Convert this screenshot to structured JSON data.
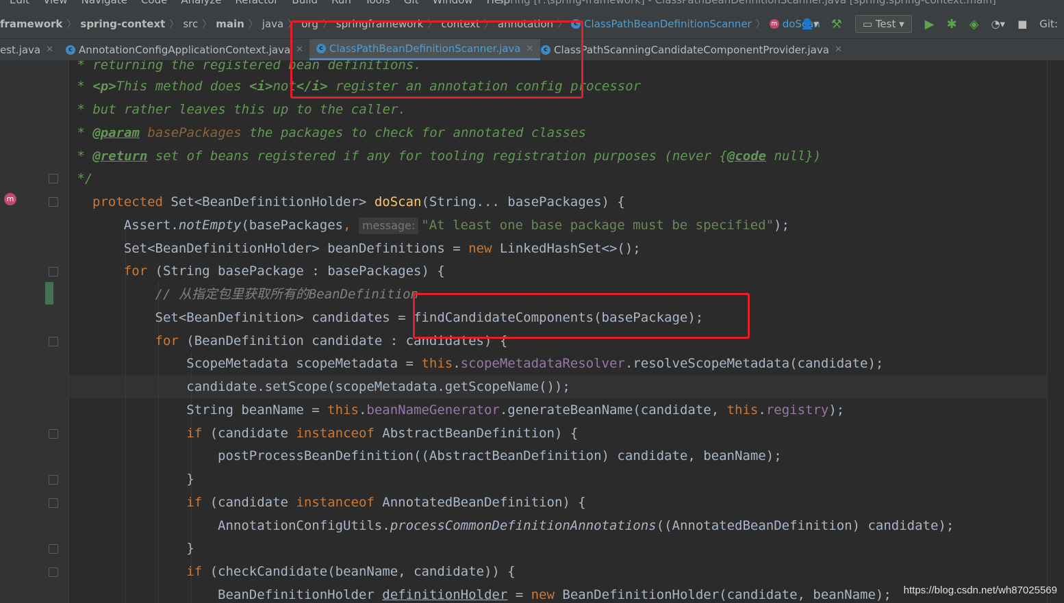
{
  "menu": {
    "items": [
      "Edit",
      "View",
      "Navigate",
      "Code",
      "Analyze",
      "Refactor",
      "Build",
      "Run",
      "Tools",
      "Git",
      "Window",
      "Help"
    ],
    "window_title": "spring [F:\\spring-framework] - ClassPathBeanDefinitionScanner.java [spring.spring-context.main]"
  },
  "breadcrumb": {
    "items": [
      "framework",
      "spring-context",
      "src",
      "main",
      "java",
      "org",
      "springframework",
      "context",
      "annotation"
    ],
    "class_crumb": "ClassPathBeanDefinitionScanner",
    "method_crumb": "doScan"
  },
  "toolbar": {
    "run_config": "Test",
    "git_label": "Git:"
  },
  "tabs": [
    {
      "label": "est.java",
      "active": false
    },
    {
      "label": "AnnotationConfigApplicationContext.java",
      "active": false
    },
    {
      "label": "ClassPathBeanDefinitionScanner.java",
      "active": true
    },
    {
      "label": "ClassPathScanningCandidateComponentProvider.java",
      "active": false
    }
  ],
  "code": {
    "doc1": " * returning the registered bean definitions.",
    "doc2a": " * ",
    "doc2b": "<p>",
    "doc2c": "This method does ",
    "doc2d": "<i>",
    "doc2e": "not",
    "doc2f": "</i>",
    "doc2g": " register an annotation config processor",
    "doc3": " * but rather leaves this up to the caller.",
    "doc4a": " * ",
    "doc4b": "@param",
    "doc4c": " basePackages",
    "doc4d": " the packages to check for annotated classes",
    "doc5a": " * ",
    "doc5b": "@return",
    "doc5c": " set of beans registered if any for tooling registration purposes (never {",
    "doc5d": "@code",
    "doc5e": " null})",
    "doc6": " */",
    "l7a": "protected",
    "l7b": " Set<BeanDefinitionHolder> ",
    "l7c": "doScan",
    "l7d": "(String... basePackages) {",
    "l8a": "    Assert.",
    "l8b": "notEmpty",
    "l8c": "(basePackages",
    "l8d": ", ",
    "l8hint": "message:",
    "l8e": "\"At least one base package must be specified\"",
    "l8f": ");",
    "l9a": "    Set<BeanDefinitionHolder> beanDefinitions = ",
    "l9b": "new",
    "l9c": " LinkedHashSet<>();",
    "l10a": "    ",
    "l10b": "for",
    "l10c": " (String basePackage : basePackages) {",
    "l11": "        // 从指定包里获取所有的BeanDefinition",
    "l12": "        Set<BeanDefinition> candidates = findCandidateComponents(basePackage);",
    "l13a": "        ",
    "l13b": "for",
    "l13c": " (BeanDefinition candidate : candidates) {",
    "l14a": "            ScopeMetadata scopeMetadata = ",
    "l14b": "this",
    "l14c": ".",
    "l14d": "scopeMetadataResolver",
    "l14e": ".resolveScopeMetadata(candidate);",
    "l15": "            candidate.setScope(scopeMetadata.getScopeName());",
    "l16a": "            String beanName = ",
    "l16b": "this",
    "l16c": ".",
    "l16d": "beanNameGenerator",
    "l16e": ".generateBeanName(candidate, ",
    "l16f": "this",
    "l16g": ".",
    "l16h": "registry",
    "l16i": ");",
    "l17a": "            ",
    "l17b": "if",
    "l17c": " (candidate ",
    "l17d": "instanceof",
    "l17e": " AbstractBeanDefinition) {",
    "l18": "                postProcessBeanDefinition((AbstractBeanDefinition) candidate, beanName);",
    "l19": "            }",
    "l20a": "            ",
    "l20b": "if",
    "l20c": " (candidate ",
    "l20d": "instanceof",
    "l20e": " AnnotatedBeanDefinition) {",
    "l21a": "                AnnotationConfigUtils.",
    "l21b": "processCommonDefinitionAnnotations",
    "l21c": "((AnnotatedBeanDefinition) candidate);",
    "l22": "            }",
    "l23a": "            ",
    "l23b": "if",
    "l23c": " (checkCandidate(beanName, candidate)) {",
    "l24a": "                BeanDefinitionHolder ",
    "l24b": "definitionHolder",
    "l24c": " = ",
    "l24d": "new",
    "l24e": " BeanDefinitionHolder(candidate, beanName);"
  },
  "watermark": "https://blog.csdn.net/wh87025569",
  "colors": {
    "keyword": "#cc7832",
    "method_decl": "#ffc66d",
    "string": "#6a8759",
    "field": "#9876aa",
    "highlight_box": "#e3202a",
    "active_tab_accent": "#4a88c7"
  }
}
